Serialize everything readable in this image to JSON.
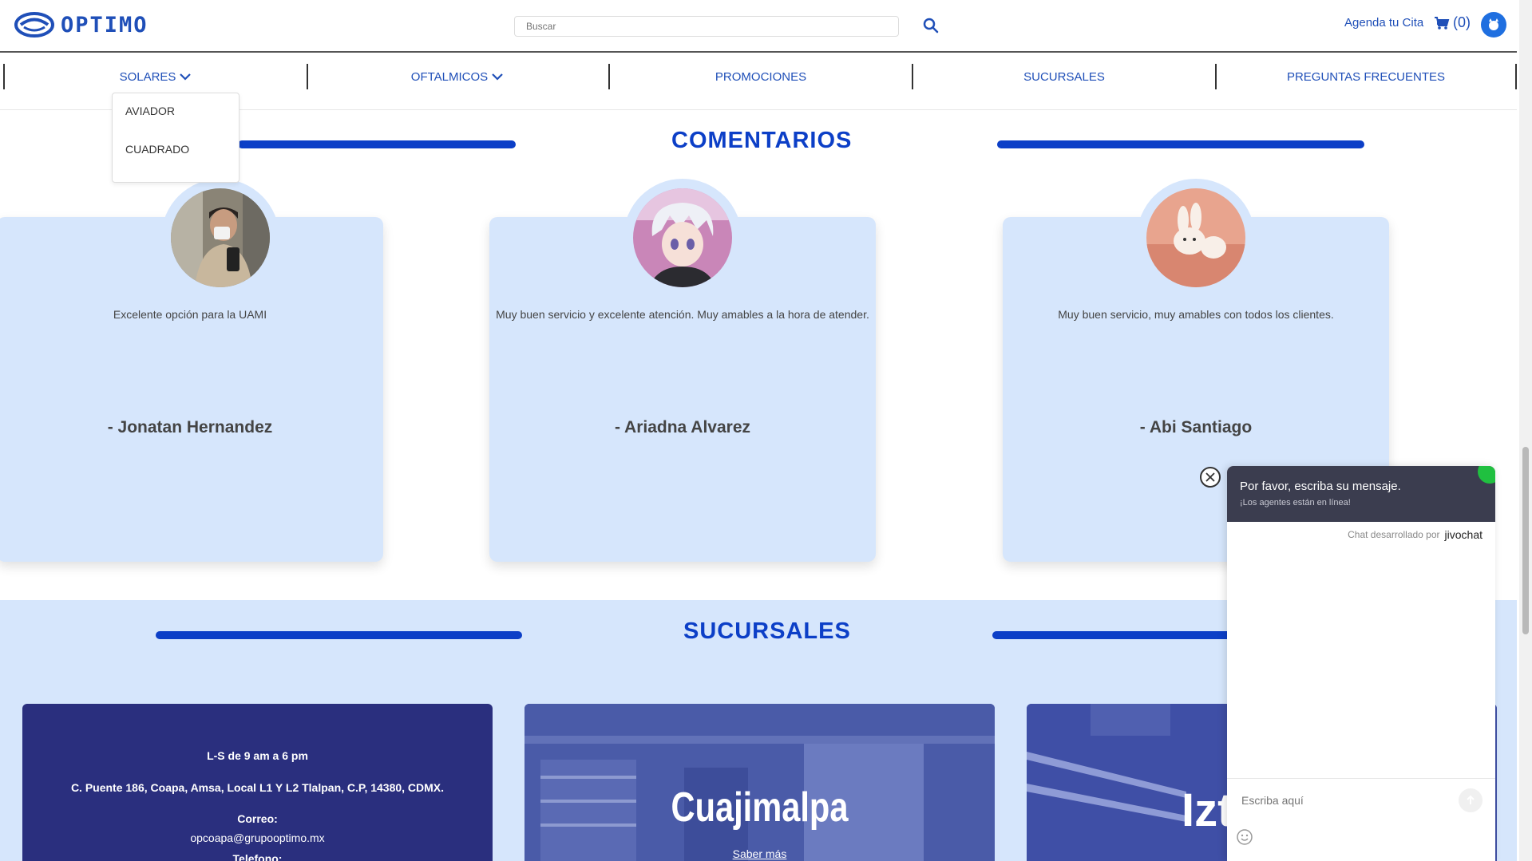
{
  "header": {
    "logo_text": "OPTIMO",
    "search_placeholder": "Buscar",
    "agenda_label": "Agenda tu Cita",
    "cart_label": "(0)"
  },
  "nav": {
    "items": [
      {
        "label": "SOLARES",
        "has_dropdown": true
      },
      {
        "label": "OFTALMICOS",
        "has_dropdown": true
      },
      {
        "label": "PROMOCIONES",
        "has_dropdown": false
      },
      {
        "label": "SUCURSALES",
        "has_dropdown": false
      },
      {
        "label": "PREGUNTAS FRECUENTES",
        "has_dropdown": false
      }
    ],
    "dropdown_items": [
      "AVIADOR",
      "CUADRADO"
    ]
  },
  "comentarios": {
    "title": "COMENTARIOS",
    "cards": [
      {
        "text": "Excelente opción para la UAMI",
        "name": "- Jonatan Hernandez"
      },
      {
        "text": "Muy buen servicio y excelente atención. Muy amables a la hora de atender.",
        "name": "- Ariadna Alvarez"
      },
      {
        "text": "Muy buen servicio, muy amables con todos los clientes.",
        "name": "- Abi Santiago"
      }
    ]
  },
  "sucursales": {
    "title": "SUCURSALES",
    "info_card": {
      "hours": "L-S de 9 am a 6 pm",
      "address": "C. Puente 186, Coapa, Amsa, Local L1 Y L2 Tlalpan, C.P, 14380, CDMX.",
      "email_label": "Correo:",
      "email": "opcoapa@grupooptimo.mx",
      "phone_label": "Telefono:"
    },
    "branch_2": {
      "name": "Cuajimalpa",
      "link": "Saber más"
    },
    "branch_3": {
      "name": "Izt"
    }
  },
  "chat": {
    "title": "Por favor, escriba su mensaje.",
    "subtitle": "¡Los agentes están en línea!",
    "powered_by": "Chat desarrollado por",
    "brand": "jivochat",
    "input_placeholder": "Escriba aquí"
  },
  "colors": {
    "primary": "#0c3fc7",
    "nav_text": "#1f4fb8",
    "card_bg": "#d6e6fc",
    "info_card_bg": "#2a2f7e",
    "chat_header": "#3b3d4f"
  }
}
